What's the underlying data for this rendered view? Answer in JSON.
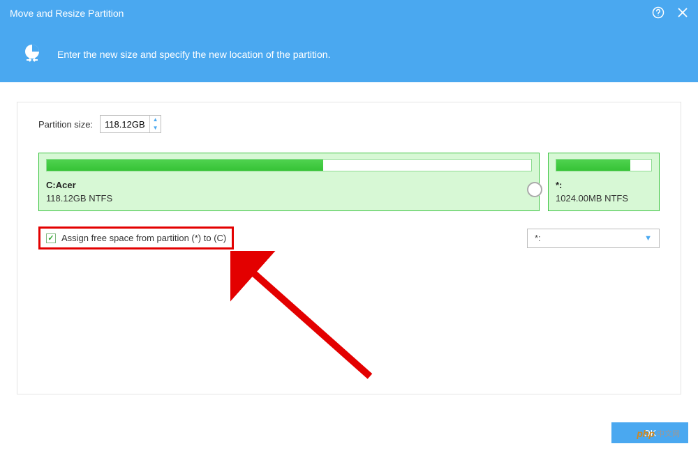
{
  "titlebar": {
    "title": "Move and Resize Partition"
  },
  "header": {
    "text": "Enter the new size and specify the new location of the partition."
  },
  "sizerow": {
    "label": "Partition size:",
    "value": "118.12GB"
  },
  "partitions": {
    "main": {
      "name": "C:Acer",
      "detail": "118.12GB NTFS",
      "fill_percent": 57
    },
    "side": {
      "name": "*:",
      "detail": "1024.00MB NTFS",
      "fill_percent": 78
    }
  },
  "assign": {
    "checked": true,
    "label": "Assign free space from partition (*) to (C)",
    "dropdown_selected": "*:"
  },
  "footer": {
    "button": "OK"
  },
  "watermark": {
    "brand": "php",
    "text": "中文网"
  }
}
